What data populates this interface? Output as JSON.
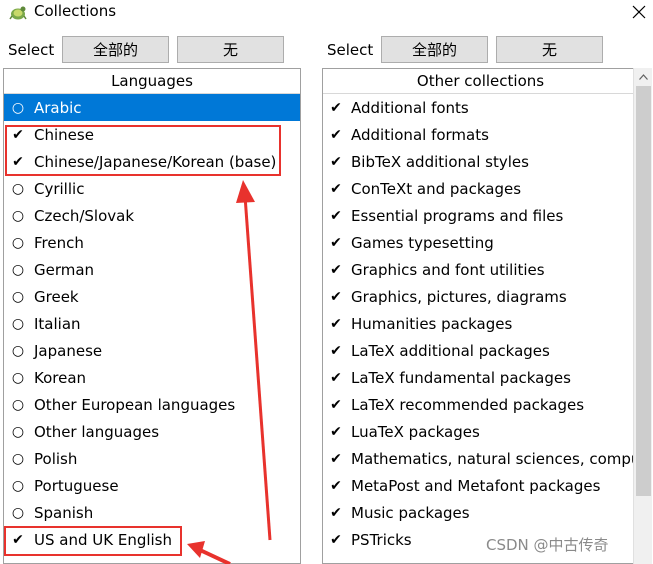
{
  "window": {
    "title": "Collections",
    "close_icon": "close-icon",
    "app_icon": "app-icon"
  },
  "left": {
    "select_label": "Select",
    "btn_all": "全部的",
    "btn_none": "无",
    "header": "Languages",
    "items": [
      {
        "mark": "○",
        "label": "Arabic"
      },
      {
        "mark": "✔",
        "label": "Chinese"
      },
      {
        "mark": "✔",
        "label": "Chinese/Japanese/Korean (base)"
      },
      {
        "mark": "○",
        "label": "Cyrillic"
      },
      {
        "mark": "○",
        "label": "Czech/Slovak"
      },
      {
        "mark": "○",
        "label": "French"
      },
      {
        "mark": "○",
        "label": "German"
      },
      {
        "mark": "○",
        "label": "Greek"
      },
      {
        "mark": "○",
        "label": "Italian"
      },
      {
        "mark": "○",
        "label": "Japanese"
      },
      {
        "mark": "○",
        "label": "Korean"
      },
      {
        "mark": "○",
        "label": "Other European languages"
      },
      {
        "mark": "○",
        "label": "Other languages"
      },
      {
        "mark": "○",
        "label": "Polish"
      },
      {
        "mark": "○",
        "label": "Portuguese"
      },
      {
        "mark": "○",
        "label": "Spanish"
      },
      {
        "mark": "✔",
        "label": "US and UK English"
      }
    ]
  },
  "right": {
    "select_label": "Select",
    "btn_all": "全部的",
    "btn_none": "无",
    "header": "Other collections",
    "items": [
      {
        "mark": "✔",
        "label": "Additional fonts"
      },
      {
        "mark": "✔",
        "label": "Additional formats"
      },
      {
        "mark": "✔",
        "label": "BibTeX additional styles"
      },
      {
        "mark": "✔",
        "label": "ConTeXt and packages"
      },
      {
        "mark": "✔",
        "label": "Essential programs and files"
      },
      {
        "mark": "✔",
        "label": "Games typesetting"
      },
      {
        "mark": "✔",
        "label": "Graphics and font utilities"
      },
      {
        "mark": "✔",
        "label": "Graphics, pictures, diagrams"
      },
      {
        "mark": "✔",
        "label": "Humanities packages"
      },
      {
        "mark": "✔",
        "label": "LaTeX additional packages"
      },
      {
        "mark": "✔",
        "label": "LaTeX fundamental packages"
      },
      {
        "mark": "✔",
        "label": "LaTeX recommended packages"
      },
      {
        "mark": "✔",
        "label": "LuaTeX packages"
      },
      {
        "mark": "✔",
        "label": "Mathematics, natural sciences, compu"
      },
      {
        "mark": "✔",
        "label": "MetaPost and Metafont packages"
      },
      {
        "mark": "✔",
        "label": "Music packages"
      },
      {
        "mark": "✔",
        "label": "PSTricks"
      }
    ]
  },
  "watermark": "CSDN @中古传奇",
  "colors": {
    "selection": "#0078d7",
    "annotation": "#e8322d"
  }
}
